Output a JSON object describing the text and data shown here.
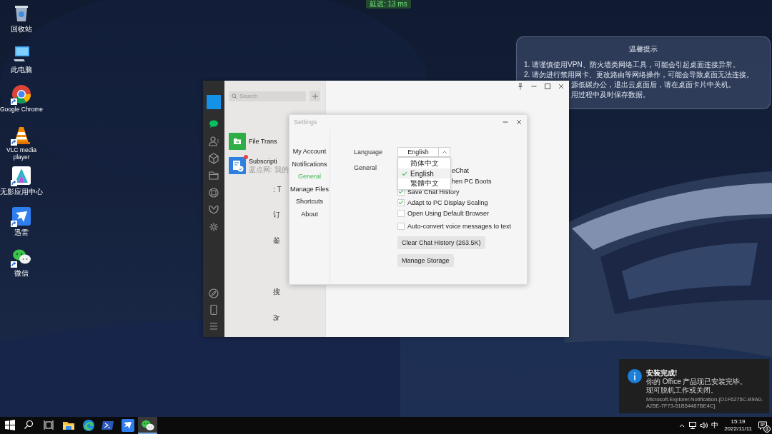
{
  "latency": "延迟: 13 ms",
  "desktop_icons": [
    {
      "label": "回收站",
      "kind": "trash",
      "shortcut": false
    },
    {
      "label": "此电脑",
      "kind": "computer",
      "shortcut": false
    },
    {
      "label": "Google Chrome",
      "kind": "chrome",
      "shortcut": true
    },
    {
      "label": "VLC media player",
      "kind": "vlc",
      "shortcut": true
    },
    {
      "label": "无影应用中心",
      "kind": "wuying",
      "shortcut": true
    },
    {
      "label": "迅雷",
      "kind": "xunlei",
      "shortcut": true
    },
    {
      "label": "微信",
      "kind": "wechat",
      "shortcut": true
    }
  ],
  "notice": {
    "title": "温馨提示",
    "lines": [
      {
        "text": "1. 请谨慎使用VPN、防火墙类网络工具，可能会引起桌面连接异常。",
        "covered": false
      },
      {
        "text": "2. 请勿进行禁用网卡、更改路由等网络操作，可能会导致桌面无法连接。",
        "covered": false
      },
      {
        "text": "源低碳办公，退出云桌面后，请在桌面卡片中关机。",
        "covered": true
      },
      {
        "text": "用过程中及时保存数据。",
        "covered": true
      }
    ]
  },
  "wechat": {
    "sidebar": [
      {
        "kind": "chats",
        "selected": true
      },
      {
        "kind": "contacts",
        "selected": false
      },
      {
        "kind": "favorites",
        "selected": false
      },
      {
        "kind": "files",
        "selected": false
      },
      {
        "kind": "moments",
        "selected": false
      },
      {
        "kind": "channels",
        "selected": false
      },
      {
        "kind": "discover",
        "selected": false
      }
    ],
    "sidebar_bottom": [
      {
        "kind": "miniprograms"
      },
      {
        "kind": "phone"
      },
      {
        "kind": "menu"
      }
    ],
    "search": {
      "placeholder": "Search"
    },
    "chats": [
      {
        "kind": "file-transfer",
        "name": "File Trans",
        "unread": false
      },
      {
        "kind": "subscription",
        "name": "Subscripti",
        "preview": "蓝点网: 我的",
        "unread": true
      }
    ],
    "fragments": [
      {
        "text": ": T"
      },
      {
        "text": "订"
      },
      {
        "text": "鉴"
      },
      {
        "text": "搜"
      },
      {
        "text": "3r"
      }
    ]
  },
  "settings": {
    "title": "Settings",
    "nav": [
      {
        "label": "My Account",
        "selected": false
      },
      {
        "label": "Notifications",
        "selected": false
      },
      {
        "label": "General",
        "selected": true
      },
      {
        "label": "Manage Files",
        "selected": false
      },
      {
        "label": "Shortcuts",
        "selected": false
      },
      {
        "label": "About",
        "selected": false
      }
    ],
    "language": {
      "label": "Language",
      "value": "English",
      "expanded": true,
      "options": [
        {
          "label": "简体中文",
          "selected": false
        },
        {
          "label": "English",
          "selected": true
        },
        {
          "label": "繁體中文",
          "selected": false
        }
      ]
    },
    "general": {
      "label": "General",
      "rows": [
        {
          "kind": "fragment",
          "text": "eChat"
        },
        {
          "kind": "fragment",
          "text": "hen PC Boots"
        },
        {
          "kind": "checkbox",
          "text": "Save Chat History",
          "checked": true
        },
        {
          "kind": "checkbox",
          "text": "Adapt to PC Display Scaling",
          "checked": true
        },
        {
          "kind": "checkbox",
          "text": "Open Using Default Browser",
          "checked": false
        },
        {
          "kind": "checkbox",
          "text": "Auto-convert voice messages to text",
          "checked": false
        }
      ]
    },
    "buttons": [
      "Clear Chat History (263.5K)",
      "Manage Storage"
    ]
  },
  "toast": {
    "title": "安装完成!",
    "lines": [
      "你的 Office 产品现已安装完毕。",
      "现可脱机工作或关闭。"
    ],
    "source": "Microsoft.Explorer.Notification.{D1F6275C-B9A0-A25E-7F73-51B54487BE4C}"
  },
  "taskbar": [
    {
      "kind": "start",
      "active": false
    },
    {
      "kind": "search",
      "active": false
    },
    {
      "kind": "taskview",
      "active": false
    },
    {
      "kind": "explorer",
      "active": false
    },
    {
      "kind": "edge",
      "active": false
    },
    {
      "kind": "terminal",
      "active": false
    },
    {
      "kind": "xunlei",
      "active": false
    },
    {
      "kind": "wechat",
      "active": true
    }
  ],
  "tray": {
    "ime": "中",
    "time": "15:19",
    "date": "2022/11/11",
    "badge": "1"
  }
}
